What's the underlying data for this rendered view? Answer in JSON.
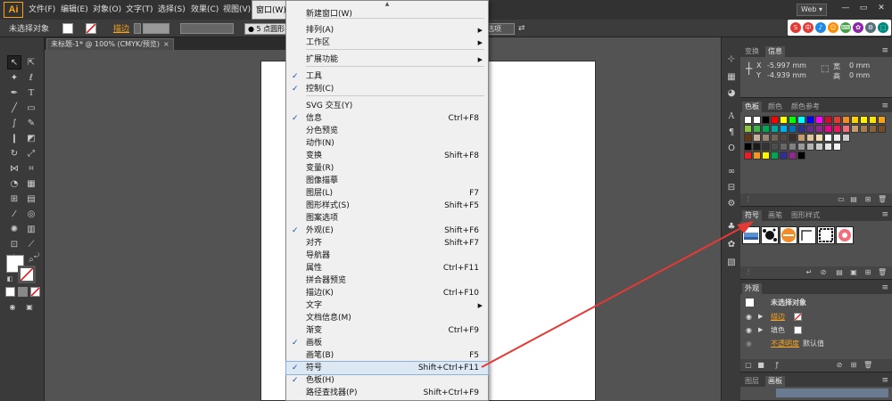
{
  "colors": {
    "accent": "#f7a21b",
    "annotation": "#e53935",
    "check": "#1a4fa8"
  },
  "app": {
    "logo": "Ai"
  },
  "menubar": {
    "items": [
      "文件(F)",
      "编辑(E)",
      "对象(O)",
      "文字(T)",
      "选择(S)",
      "效果(C)",
      "视图(V)",
      "窗口(W)"
    ],
    "workspace": "Web ▾",
    "window_controls": [
      "—",
      "▭",
      "✕"
    ]
  },
  "ime": {
    "items": [
      "S",
      "中",
      "♪",
      "☺",
      "⌨",
      "✿",
      "⚙",
      "⬚"
    ]
  },
  "controlbar": {
    "selection_label": "未选择对象",
    "stroke_label": "描边",
    "brush_value": "5 点圆形",
    "doc_setup": "选项"
  },
  "document": {
    "tab_title": "未标题-1* @ 100% (CMYK/预览)",
    "close": "×"
  },
  "window_menu": {
    "scroll_up": "▲",
    "items": [
      {
        "label": "新建窗口(W)",
        "shortcut": "",
        "checked": false,
        "submenu": false
      },
      {
        "label": "排列(A)",
        "shortcut": "",
        "checked": false,
        "submenu": true
      },
      {
        "label": "工作区",
        "shortcut": "",
        "checked": false,
        "submenu": true
      },
      {
        "label": "扩展功能",
        "shortcut": "",
        "checked": false,
        "submenu": true
      },
      {
        "label": "工具",
        "shortcut": "",
        "checked": true,
        "submenu": false
      },
      {
        "label": "控制(C)",
        "shortcut": "",
        "checked": true,
        "submenu": false
      },
      {
        "label": "SVG 交互(Y)",
        "shortcut": "",
        "checked": false,
        "submenu": false
      },
      {
        "label": "信息",
        "shortcut": "Ctrl+F8",
        "checked": true,
        "submenu": false
      },
      {
        "label": "分色预览",
        "shortcut": "",
        "checked": false,
        "submenu": false
      },
      {
        "label": "动作(N)",
        "shortcut": "",
        "checked": false,
        "submenu": false
      },
      {
        "label": "变换",
        "shortcut": "Shift+F8",
        "checked": false,
        "submenu": false
      },
      {
        "label": "变量(R)",
        "shortcut": "",
        "checked": false,
        "submenu": false
      },
      {
        "label": "图像描摹",
        "shortcut": "",
        "checked": false,
        "submenu": false
      },
      {
        "label": "图层(L)",
        "shortcut": "F7",
        "checked": false,
        "submenu": false
      },
      {
        "label": "图形样式(S)",
        "shortcut": "Shift+F5",
        "checked": false,
        "submenu": false
      },
      {
        "label": "图案选项",
        "shortcut": "",
        "checked": false,
        "submenu": false
      },
      {
        "label": "外观(E)",
        "shortcut": "Shift+F6",
        "checked": true,
        "submenu": false
      },
      {
        "label": "对齐",
        "shortcut": "Shift+F7",
        "checked": false,
        "submenu": false
      },
      {
        "label": "导航器",
        "shortcut": "",
        "checked": false,
        "submenu": false
      },
      {
        "label": "属性",
        "shortcut": "Ctrl+F11",
        "checked": false,
        "submenu": false
      },
      {
        "label": "拼合器预览",
        "shortcut": "",
        "checked": false,
        "submenu": false
      },
      {
        "label": "描边(K)",
        "shortcut": "Ctrl+F10",
        "checked": false,
        "submenu": false
      },
      {
        "label": "文字",
        "shortcut": "",
        "checked": false,
        "submenu": true
      },
      {
        "label": "文档信息(M)",
        "shortcut": "",
        "checked": false,
        "submenu": false
      },
      {
        "label": "渐变",
        "shortcut": "Ctrl+F9",
        "checked": false,
        "submenu": false
      },
      {
        "label": "画板",
        "shortcut": "",
        "checked": true,
        "submenu": false
      },
      {
        "label": "画笔(B)",
        "shortcut": "F5",
        "checked": false,
        "submenu": false
      },
      {
        "label": "符号",
        "shortcut": "Shift+Ctrl+F11",
        "checked": true,
        "submenu": false,
        "highlighted": true
      },
      {
        "label": "色板(H)",
        "shortcut": "",
        "checked": true,
        "submenu": false
      },
      {
        "label": "路径查找器(P)",
        "shortcut": "Shift+Ctrl+F9",
        "checked": false,
        "submenu": false
      }
    ]
  },
  "panels": {
    "info": {
      "tabs": [
        "变换",
        "信息"
      ],
      "x_label": "X",
      "x_value": "-5.997 mm",
      "y_label": "Y",
      "y_value": "-4.939 mm",
      "w_label": "宽",
      "w_value": "0 mm",
      "h_label": "高",
      "h_value": "0 mm"
    },
    "swatches": {
      "tabs": [
        "色板",
        "颜色",
        "颜色参考"
      ],
      "rows": [
        [
          "#ffffff",
          "#ffffff",
          "#000000",
          "#ff0000",
          "#ffff00",
          "#00ff00",
          "#00ffff",
          "#0000ff",
          "#ff00ff",
          "#c8102e",
          "#e03c31",
          "#f28c28",
          "#ffd100",
          "#fff200",
          "#fce300",
          "#f7a21b"
        ],
        [
          "#8dc63f",
          "#39b54a",
          "#00a651",
          "#00a99d",
          "#00aeef",
          "#0072bc",
          "#2e3192",
          "#662d91",
          "#92278f",
          "#ec008c",
          "#ed145b",
          "#f26d7d",
          "#c69c6d",
          "#a67c52",
          "#8c6239",
          "#754c24"
        ],
        [
          "#603913",
          "#c7b299",
          "#998675",
          "#736357",
          "#534741",
          "#37302b",
          "#c69c6d",
          "#e2c49c",
          "#f5deb3",
          "#ffffff",
          "#eeeeee",
          "#cccccc"
        ],
        [
          "#000000",
          "#1a1a1a",
          "#333333",
          "#4d4d4d",
          "#666666",
          "#808080",
          "#999999",
          "#b3b3b3",
          "#cccccc",
          "#e6e6e6",
          "#f2f2f2"
        ],
        [
          "#ed1c24",
          "#f7941d",
          "#fff200",
          "#00a651",
          "#2e3192",
          "#92278f",
          "#000000"
        ]
      ]
    },
    "symbols": {
      "tabs": [
        "符号",
        "画笔",
        "图形样式"
      ]
    },
    "appearance": {
      "tabs": [
        "外观"
      ],
      "title": "未选择对象",
      "stroke_label": "描边",
      "fill_label": "填色",
      "opacity_label": "不透明度",
      "opacity_value": "默认值"
    },
    "bottom": {
      "tabs": [
        "图层",
        "画板"
      ]
    }
  }
}
